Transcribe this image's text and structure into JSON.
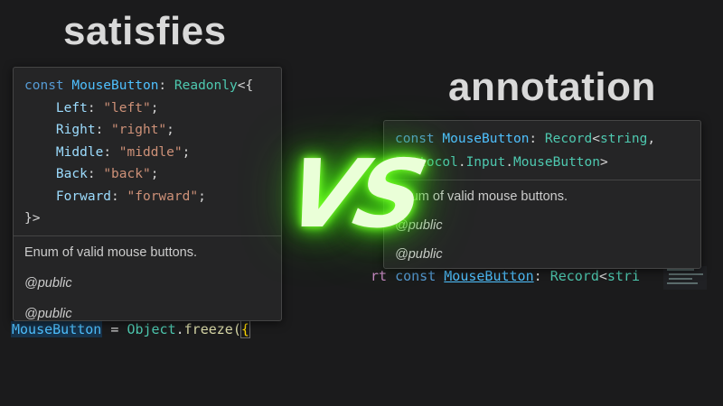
{
  "headings": {
    "left": "satisfies",
    "right": "annotation"
  },
  "vs_label": "VS",
  "left_hover": {
    "code": {
      "kw": "const",
      "ident": "MouseButton",
      "colon": ":",
      "type": "Readonly",
      "open": "<{",
      "props": [
        {
          "key": "Left",
          "value": "\"left\""
        },
        {
          "key": "Right",
          "value": "\"right\""
        },
        {
          "key": "Middle",
          "value": "\"middle\""
        },
        {
          "key": "Back",
          "value": "\"back\""
        },
        {
          "key": "Forward",
          "value": "\"forward\""
        }
      ],
      "close": "}>"
    },
    "description": "Enum of valid mouse buttons.",
    "tags": [
      "@public",
      "@public"
    ]
  },
  "right_hover": {
    "code": {
      "kw": "const",
      "ident": "MouseButton",
      "colon": ":",
      "type": "Record",
      "lt": "<",
      "arg1": "string",
      "comma": ",",
      "ns1": "Protocol",
      "dot1": ".",
      "ns2": "Input",
      "dot2": ".",
      "ns3": "MouseButton",
      "gt": ">"
    },
    "description": "Enum of valid mouse buttons.",
    "tags": [
      "@public",
      "@public"
    ]
  },
  "left_code_line": {
    "ident": "MouseButton",
    "eq": " = ",
    "obj": "Object",
    "dot": ".",
    "fn": "freeze",
    "paren": "(",
    "brace": "{"
  },
  "right_code_line": {
    "kw1": "rt",
    "kw2": "const",
    "ident": "MouseButton",
    "colon": ":",
    "type": "Record",
    "lt": "<",
    "arg": "stri"
  },
  "colors": {
    "background": "#1b1b1c",
    "hover_bg": "#252526",
    "glow": "#5cff1a",
    "keyword": "#569cd6",
    "identifier": "#4fc1ff",
    "type": "#4ec9b0",
    "string": "#ce9178"
  }
}
